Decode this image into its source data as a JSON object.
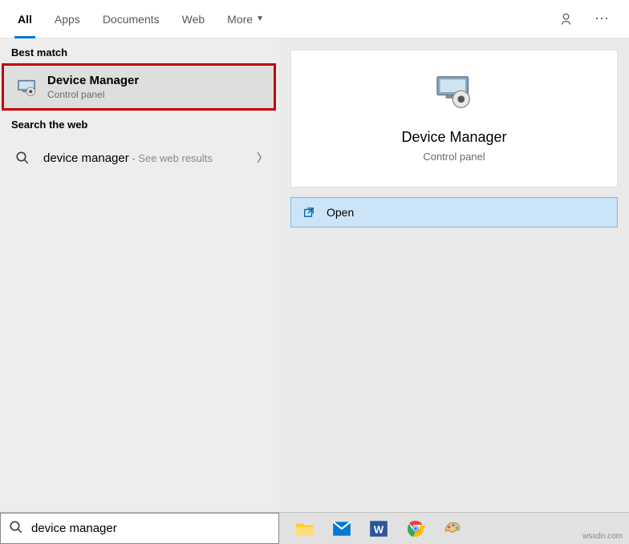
{
  "tabs": {
    "all": "All",
    "apps": "Apps",
    "documents": "Documents",
    "web": "Web",
    "more": "More"
  },
  "left": {
    "best_match_label": "Best match",
    "result": {
      "title": "Device Manager",
      "subtitle": "Control panel"
    },
    "search_web_label": "Search the web",
    "web_result": {
      "query": "device manager",
      "suffix": " - See web results"
    }
  },
  "preview": {
    "title": "Device Manager",
    "subtitle": "Control panel",
    "open_label": "Open"
  },
  "search": {
    "value": "device manager"
  },
  "watermark": "wsxdn.com"
}
